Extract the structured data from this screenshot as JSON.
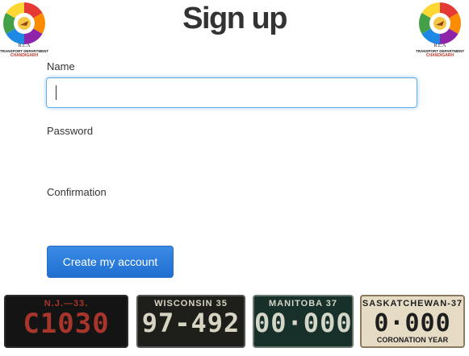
{
  "page": {
    "title": "Sign up"
  },
  "logo": {
    "line1": "R.L.A",
    "line2": "TRANSPORT DEPARTMENT",
    "line3": "CHANDIGARH"
  },
  "form": {
    "name_label": "Name",
    "name_value": "",
    "password_label": "Password",
    "confirmation_label": "Confirmation",
    "submit_label": "Create my account"
  },
  "colors": {
    "accent": "#1f6fd2",
    "focus_border": "#66afe9",
    "title": "#333333"
  },
  "plates": [
    {
      "top": "N.J.—33.",
      "number": "C1030",
      "bottom": ""
    },
    {
      "top": "WISCONSIN 35",
      "number": "97-492",
      "bottom": ""
    },
    {
      "top": "MANITOBA 37",
      "number": "00·000",
      "bottom": ""
    },
    {
      "top": "SASKATCHEWAN-37",
      "number": "0·000",
      "bottom": "CORONATION YEAR"
    }
  ]
}
